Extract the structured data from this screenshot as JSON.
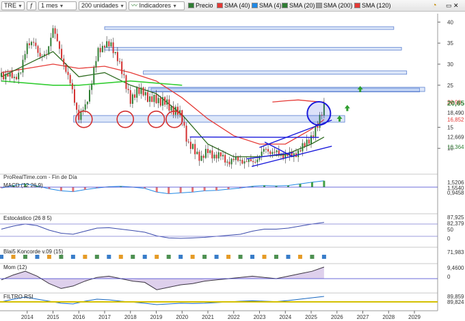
{
  "toolbar": {
    "symbol": "TRE",
    "period": "1 mes",
    "units": "200 unidades",
    "indicators_label": "Indicadores",
    "legend": [
      {
        "label": "Precio",
        "color": "#2e7d32"
      },
      {
        "label": "SMA (40)",
        "color": "#e53935"
      },
      {
        "label": "SMA (4)",
        "color": "#1e88e5"
      },
      {
        "label": "SMA (20)",
        "color": "#2e7d32"
      },
      {
        "label": "SMA (200)",
        "color": "#9e9e9e"
      },
      {
        "label": "SMA (120)",
        "color": "#e53935"
      }
    ]
  },
  "source_label": "ProRealTime.com - Fin de Día",
  "panels": {
    "macd": {
      "label": "MACD (12 26 9)",
      "axis_labels": [
        "1,5206",
        "1,5540",
        "0,9458"
      ]
    },
    "stoch": {
      "label": "Estocástico (26 8 5)",
      "axis_labels": [
        "87,925",
        "82,379",
        "50",
        "0"
      ]
    },
    "koncorde": {
      "label": "Blai5 Koncorde v.09 (15)",
      "axis_labels": [
        "71,983"
      ]
    },
    "mom": {
      "label": "Mom (12)",
      "axis_labels": [
        "9,4600",
        "0"
      ]
    },
    "filtro": {
      "label": "FILTRO RSI",
      "axis_labels": [
        "89,859",
        "89,824"
      ]
    }
  },
  "price_scale": {
    "ticks": [
      "40",
      "35",
      "30",
      "25",
      "15",
      "10"
    ],
    "labels": [
      {
        "text": "20,98",
        "color": "#e53935"
      },
      {
        "text": "20,65",
        "color": "#2e7d32"
      },
      {
        "text": "18,490",
        "color": "#333333"
      },
      {
        "text": "16,852",
        "color": "#e53935"
      },
      {
        "text": "12,669",
        "color": "#333333"
      },
      {
        "text": "10,364",
        "color": "#2e7d32"
      }
    ]
  },
  "colors": {
    "bull": "#2e7d32",
    "bear": "#d32f2f",
    "sma40": "#e53935",
    "sma20": "#2e6b1f",
    "sma200": "#32cd32",
    "trend": "#1a1adb"
  },
  "chart_data": {
    "type": "line",
    "symbol": "TRE",
    "x_ticks": [
      "2014",
      "2015",
      "2016",
      "2017",
      "2018",
      "2019",
      "2020",
      "2021",
      "2022",
      "2023",
      "2024",
      "2025",
      "2026",
      "2027",
      "2028",
      "2029"
    ],
    "ylim": [
      5,
      42
    ],
    "yticks": [
      10,
      15,
      25,
      30,
      35,
      40
    ],
    "price": {
      "x": [
        2013.0,
        2013.25,
        2013.5,
        2013.75,
        2014.0,
        2014.25,
        2014.5,
        2014.75,
        2015.0,
        2015.25,
        2015.5,
        2015.75,
        2016.0,
        2016.25,
        2016.5,
        2016.75,
        2017.0,
        2017.25,
        2017.5,
        2017.75,
        2018.0,
        2018.25,
        2018.5,
        2018.75,
        2019.0,
        2019.25,
        2019.5,
        2019.75,
        2020.0,
        2020.25,
        2020.5,
        2020.75,
        2021.0,
        2021.25,
        2021.5,
        2021.75,
        2022.0,
        2022.25,
        2022.5,
        2022.75,
        2023.0,
        2023.25,
        2023.5,
        2023.75,
        2024.0,
        2024.25,
        2024.5,
        2024.75,
        2025.0,
        2025.25,
        2025.5
      ],
      "y": [
        27,
        28,
        26,
        29,
        34,
        36,
        31,
        33,
        38,
        34,
        28,
        24,
        17,
        20,
        26,
        33,
        35,
        34,
        32,
        26,
        22,
        23,
        24,
        21,
        22,
        21,
        20,
        19,
        17,
        11,
        9,
        8,
        9,
        8.5,
        8,
        7,
        7,
        7.5,
        6.5,
        7,
        8,
        10,
        9,
        8.5,
        8.5,
        8,
        9.5,
        10.5,
        13,
        15,
        20.65
      ]
    },
    "series": [
      {
        "name": "SMA (40)",
        "x": [
          2013.0,
          2014.0,
          2015.0,
          2016.0,
          2017.0,
          2018.0,
          2019.0,
          2020.0,
          2021.0,
          2022.0,
          2023.0,
          2024.0,
          2025.0,
          2025.5
        ],
        "y": [
          28,
          29,
          30,
          29,
          29.5,
          28,
          26,
          22,
          17,
          13,
          11,
          11,
          14.5,
          16.85
        ]
      },
      {
        "name": "SMA (20)",
        "x": [
          2013.0,
          2014.0,
          2015.0,
          2016.0,
          2017.0,
          2018.0,
          2019.0,
          2020.0,
          2021.0,
          2022.0,
          2023.0,
          2024.0,
          2025.0,
          2025.5
        ],
        "y": [
          27,
          30,
          33,
          27,
          28,
          25,
          23,
          18,
          11,
          8,
          8,
          8.5,
          11,
          12.67
        ]
      },
      {
        "name": "SMA (200)",
        "x": [
          2013.0,
          2014.0,
          2015.0,
          2016.0,
          2017.0,
          2018.0,
          2019.0,
          2020.0
        ],
        "y": [
          26,
          25.5,
          25,
          25,
          25.5,
          26,
          25.5,
          25
        ]
      },
      {
        "name": "SMA (120)",
        "x": [
          2023.5,
          2024.0,
          2024.5,
          2025.0,
          2025.5
        ],
        "y": [
          21,
          21.3,
          21.5,
          21.2,
          20.98
        ]
      }
    ],
    "resistance_zones": [
      {
        "from": 2015.8,
        "to": 2026.3,
        "y": [
          16.2,
          17.8
        ]
      },
      {
        "from": 2017.0,
        "to": 2028.2,
        "y": [
          38.3,
          38.9
        ]
      },
      {
        "from": 2017.0,
        "to": 2028.5,
        "y": [
          33.4,
          34.0
        ]
      },
      {
        "from": 2018.5,
        "to": 2028.7,
        "y": [
          27.6,
          28.4
        ]
      },
      {
        "from": 2018.8,
        "to": 2029.2,
        "y": [
          23.4,
          24.3
        ]
      },
      {
        "from": 2018.7,
        "to": 2029.4,
        "y": [
          23.5,
          24.5
        ]
      }
    ],
    "markers": {
      "circles": [
        2016.2,
        2017.8,
        2019.0,
        2019.7
      ],
      "target_circle": 2025.3,
      "up_arrows": [
        {
          "x": 2026.1,
          "y": 17
        },
        {
          "x": 2026.4,
          "y": 19.5
        },
        {
          "x": 2026.9,
          "y": 24
        }
      ]
    },
    "indicators": {
      "macd": [
        -0.2,
        0.4,
        0.8,
        0.3,
        -0.4,
        -0.9,
        -1.1,
        -0.6,
        -0.2,
        0.1,
        0.2,
        0.0,
        -0.3,
        -1.2,
        -1.6,
        -1.4,
        -1.2,
        -0.9,
        -0.8,
        -0.5,
        -0.2,
        0.2,
        0.4,
        0.3,
        0.4,
        0.8,
        1.2,
        1.55
      ],
      "stoch": [
        55,
        70,
        80,
        72,
        50,
        35,
        30,
        45,
        60,
        62,
        55,
        48,
        40,
        22,
        12,
        10,
        12,
        15,
        20,
        25,
        30,
        45,
        55,
        55,
        60,
        70,
        80,
        87.9
      ],
      "mom": [
        -1,
        3,
        6,
        2,
        -4,
        -8,
        -6,
        -2,
        1,
        2,
        0,
        -2,
        -3,
        -9,
        -7,
        -5,
        -4,
        -2,
        -1,
        0,
        1,
        2,
        1,
        0,
        2,
        4,
        6,
        9.46
      ],
      "rsi": [
        50,
        70,
        85,
        70,
        55,
        40,
        35,
        55,
        70,
        65,
        55,
        48,
        40,
        30,
        35,
        40,
        38,
        40,
        45,
        50,
        55,
        58,
        55,
        52,
        60,
        70,
        80,
        89.8
      ]
    }
  }
}
